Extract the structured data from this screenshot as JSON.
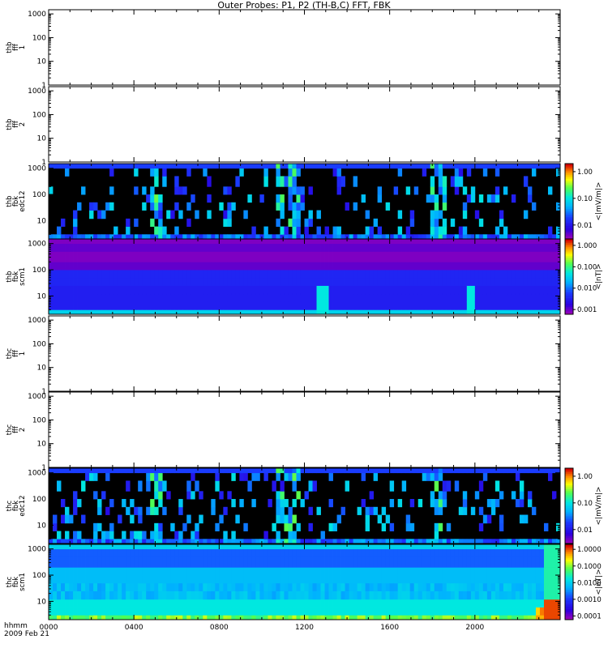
{
  "title": "Outer Probes: P1, P2 (TH-B,C) FFT, FBK",
  "time_axis": {
    "row_label": "hhmm",
    "date_label": "2009 Feb 21",
    "ticks": [
      "0000",
      "0400",
      "0800",
      "1200",
      "1600",
      "2000"
    ],
    "tick_hours": [
      0,
      4,
      8,
      12,
      16,
      20
    ],
    "range_hours": [
      0,
      24
    ]
  },
  "freq_axis": {
    "scale": "log",
    "ticks": [
      "1",
      "10",
      "100",
      "1000"
    ],
    "tick_values": [
      1,
      10,
      100,
      1000
    ]
  },
  "chart_data": {
    "type": "heatmap",
    "panels": [
      {
        "id": "thb-fff1",
        "label_lines": [
          "thb",
          "fff",
          "1"
        ],
        "has_data": false,
        "ylim": [
          1,
          1500
        ]
      },
      {
        "id": "thb-fff2",
        "label_lines": [
          "thb",
          "fff",
          "2"
        ],
        "has_data": false,
        "ylim": [
          1,
          1500
        ]
      },
      {
        "id": "thb-fbk-edc12",
        "label_lines": [
          "thb",
          "fbk",
          "edc12"
        ],
        "has_data": true,
        "ylim": [
          2,
          1500
        ],
        "colorbar": {
          "label": "<|mV/m|>",
          "ticks": [
            "1.00",
            "0.10",
            "0.01"
          ],
          "tick_values": [
            1,
            0.1,
            0.01
          ],
          "range": [
            0.003,
            2
          ]
        }
      },
      {
        "id": "thb-fbk-scm1",
        "label_lines": [
          "thb",
          "fbk",
          "scm1"
        ],
        "has_data": true,
        "ylim": [
          2,
          1500
        ],
        "colorbar": {
          "label": "<|nT|>",
          "ticks": [
            "1.000",
            "0.100",
            "0.010",
            "0.001"
          ],
          "tick_values": [
            1,
            0.1,
            0.01,
            0.001
          ],
          "range": [
            0.0006,
            2
          ]
        }
      },
      {
        "id": "thc-fff1",
        "label_lines": [
          "thc",
          "fff",
          "1"
        ],
        "has_data": false,
        "ylim": [
          1,
          1500
        ]
      },
      {
        "id": "thc-fff2",
        "label_lines": [
          "thc",
          "fff",
          "2"
        ],
        "has_data": false,
        "ylim": [
          1,
          1500
        ]
      },
      {
        "id": "thc-fbk-edc12",
        "label_lines": [
          "thc",
          "fbk",
          "edc12"
        ],
        "has_data": true,
        "ylim": [
          2,
          1500
        ],
        "colorbar": {
          "label": "<|mV/m|>",
          "ticks": [
            "1.00",
            "0.10",
            "0.01"
          ],
          "tick_values": [
            1,
            0.1,
            0.01
          ],
          "range": [
            0.003,
            2
          ]
        }
      },
      {
        "id": "thc-fbk-scm1",
        "label_lines": [
          "thc",
          "fbk",
          "scm1"
        ],
        "has_data": true,
        "ylim": [
          2,
          1500
        ],
        "colorbar": {
          "label": "<|nT|>",
          "ticks": [
            "1.0000",
            "0.1000",
            "0.0100",
            "0.0010",
            "0.0001"
          ],
          "tick_values": [
            1,
            0.1,
            0.01,
            0.001,
            0.0001
          ],
          "range": [
            6e-05,
            2
          ]
        }
      }
    ]
  }
}
